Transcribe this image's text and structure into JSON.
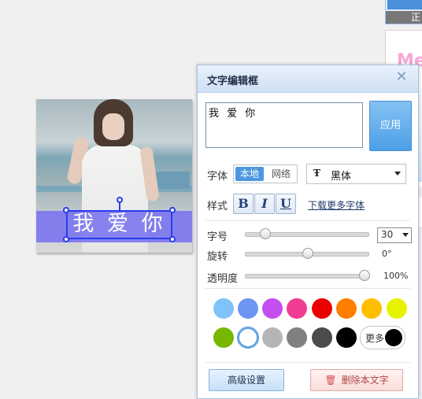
{
  "right_strip": {
    "top_thumb_caption": "正常",
    "second_thumb_text": "Me"
  },
  "photo": {
    "overlay_text": "我 爱 你",
    "band_color": "#7670f0",
    "selection_color": "#2b3cf0"
  },
  "dialog": {
    "title": "文字编辑框",
    "close_icon": "close-icon",
    "text_value": "我 爱 你",
    "apply_label": "应用",
    "font_label": "字体",
    "font_source_options": [
      "本地",
      "网络"
    ],
    "font_source_selected": "本地",
    "font_type_icon": "Ŧ",
    "font_name": "黑体",
    "style_label": "样式",
    "style_buttons": [
      "B",
      "I",
      "U"
    ],
    "more_fonts_link": "下载更多字体",
    "size_label": "字号",
    "size_value": "30",
    "size_slider_fraction": 0.16,
    "rotate_label": "旋转",
    "rotate_value": "0°",
    "rotate_slider_fraction": 0.5,
    "opacity_label": "透明度",
    "opacity_value": "100%",
    "opacity_slider_fraction": 1.0,
    "colors_row1": [
      "#7fc3f8",
      "#6f95f4",
      "#c44ff0",
      "#f03c93",
      "#e90000",
      "#ff7e00",
      "#ffbe00",
      "#e6f200"
    ],
    "colors_row2": [
      "#76b800",
      "#ffffff",
      "#b5b5b5",
      "#808080",
      "#4c4c4c",
      "#000000"
    ],
    "selected_color": "#ffffff",
    "more_colors_label": "更多",
    "more_colors_current": "#000000",
    "advanced_label": "高级设置",
    "delete_label": "删除本文字"
  }
}
